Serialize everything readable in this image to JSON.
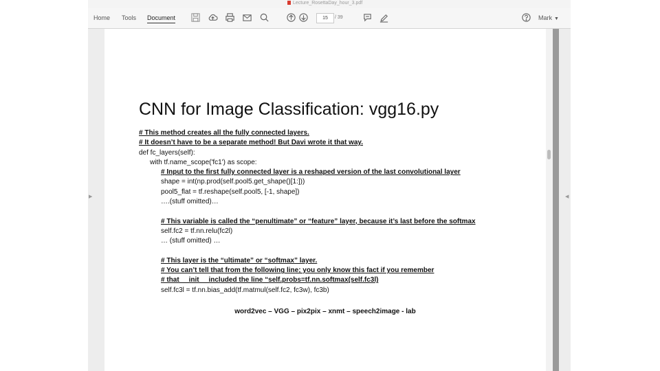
{
  "window": {
    "title": "Lecture_RosettaDay_hour_3.pdf"
  },
  "toolbar": {
    "tabs": [
      {
        "label": "Home"
      },
      {
        "label": "Tools"
      },
      {
        "label": "Document"
      }
    ],
    "page_current": "15",
    "page_total": "/ 39",
    "user_label": "Mark"
  },
  "slide": {
    "title": "CNN for Image Classification: vgg16.py",
    "lines": [
      "# This method creates all the fully connected layers.",
      "# It doesn’t have to be a separate method!  But Davi wrote it that way.",
      "def fc_layers(self):",
      "with tf.name_scope('fc1') as scope:",
      "# Input to the first fully connected layer is a reshaped version of the last convolutional layer",
      "shape = int(np.prod(self.pool5.get_shape()[1:]))",
      "pool5_flat = tf.reshape(self.pool5, [-1, shape])",
      "….(stuff omitted)…",
      "# This variable is called the “penultimate” or “feature” layer, because it’s last before the softmax",
      "self.fc2 = tf.nn.relu(fc2l)",
      "… (stuff omitted) …",
      "# This layer is the “ultimate” or “softmax” layer.",
      "# You can’t tell that from the following line; you only know this fact if you remember",
      "# that __init__ included the line “self.probs=tf.nn.softmax(self.fc3l)",
      "self.fc3l = tf.nn.bias_add(tf.matmul(self.fc2, fc3w), fc3b)"
    ],
    "footer": "word2vec – VGG – pix2pix – xnmt – speech2image - lab"
  }
}
